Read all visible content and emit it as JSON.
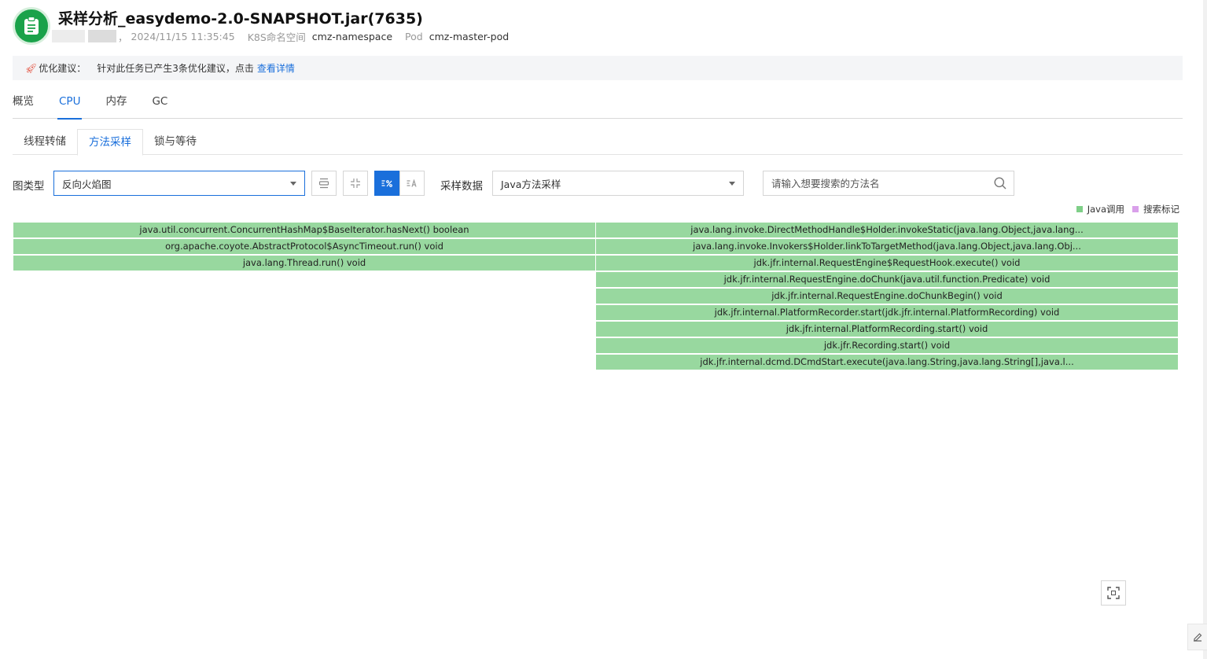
{
  "header": {
    "title": "采样分析_easydemo-2.0-SNAPSHOT.jar(7635)",
    "sep": "，",
    "datetime": "2024/11/15 11:35:45",
    "ns_label": "K8S命名空间",
    "ns_value": "cmz-namespace",
    "pod_label": "Pod",
    "pod_value": "cmz-master-pod"
  },
  "advice": {
    "label": "优化建议：",
    "text": "针对此任务已产生3条优化建议，点击",
    "link": "查看详情"
  },
  "main_tabs": [
    "概览",
    "CPU",
    "内存",
    "GC"
  ],
  "sub_tabs": [
    "线程转储",
    "方法采样",
    "锁与等待"
  ],
  "toolbar": {
    "chart_type_label": "图类型",
    "chart_type_value": "反向火焰图",
    "sample_label": "采样数据",
    "sample_value": "Java方法采样",
    "search_placeholder": "请输入想要搜索的方法名"
  },
  "legend": [
    {
      "label": "Java调用",
      "color": "#7fcf88"
    },
    {
      "label": "搜索标记",
      "color": "#d9a0ea"
    }
  ],
  "colors": {
    "accent": "#1a6fdb",
    "frame": "#98d89f",
    "app_icon": "#1aa24a"
  },
  "flame": {
    "left": [
      "java.util.concurrent.ConcurrentHashMap$BaseIterator.hasNext() boolean",
      "org.apache.coyote.AbstractProtocol$AsyncTimeout.run() void",
      "java.lang.Thread.run() void"
    ],
    "right": [
      "java.lang.invoke.DirectMethodHandle$Holder.invokeStatic(java.lang.Object,java.lang...",
      "java.lang.invoke.Invokers$Holder.linkToTargetMethod(java.lang.Object,java.lang.Obj...",
      "jdk.jfr.internal.RequestEngine$RequestHook.execute() void",
      "jdk.jfr.internal.RequestEngine.doChunk(java.util.function.Predicate) void",
      "jdk.jfr.internal.RequestEngine.doChunkBegin() void",
      "jdk.jfr.internal.PlatformRecorder.start(jdk.jfr.internal.PlatformRecording) void",
      "jdk.jfr.internal.PlatformRecording.start() void",
      "jdk.jfr.Recording.start() void",
      "jdk.jfr.internal.dcmd.DCmdStart.execute(java.lang.String,java.lang.String[],java.l..."
    ]
  }
}
